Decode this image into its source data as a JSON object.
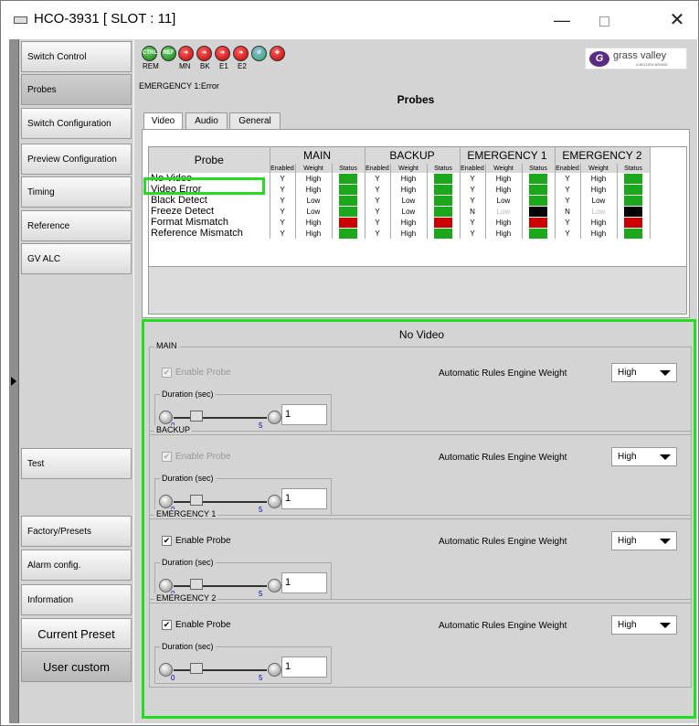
{
  "window": {
    "title": "HCO-3931 [ SLOT : 11]",
    "minimize": "—",
    "close": "✕"
  },
  "sidebar": {
    "items": [
      {
        "label": "Switch Control"
      },
      {
        "label": "Probes"
      },
      {
        "label": "Switch Configuration"
      },
      {
        "label": "Preview Configuration"
      },
      {
        "label": "Timing"
      },
      {
        "label": "Reference"
      },
      {
        "label": "GV ALC"
      },
      {
        "label": "Test"
      },
      {
        "label": "Factory/Presets"
      },
      {
        "label": "Alarm config."
      },
      {
        "label": "Information"
      },
      {
        "label": "Current Preset"
      },
      {
        "label": "User custom"
      }
    ]
  },
  "toolbar": {
    "icons": [
      {
        "text": "CTRL",
        "label": "REM",
        "color": "green"
      },
      {
        "text": "REF",
        "label": "",
        "color": "green"
      },
      {
        "text": "",
        "label": "MN",
        "color": "red"
      },
      {
        "text": "",
        "label": "BK",
        "color": "red"
      },
      {
        "text": "",
        "label": "E1",
        "color": "red"
      },
      {
        "text": "",
        "label": "E2",
        "color": "red"
      },
      {
        "text": "",
        "label": "",
        "color": "teal"
      },
      {
        "text": "",
        "label": "",
        "color": "red"
      }
    ],
    "logo_text": "grass valley",
    "logo_sub": "A BELDEN BRAND"
  },
  "status_text": "EMERGENCY 1:Error",
  "page_title": "Probes",
  "tabs": [
    "Video",
    "Audio",
    "General"
  ],
  "table": {
    "probe_header": "Probe",
    "groups": [
      "MAIN",
      "BACKUP",
      "EMERGENCY 1",
      "EMERGENCY 2"
    ],
    "sub": [
      "Enabled",
      "Weight",
      "Status"
    ],
    "rows": [
      {
        "name": "No Video",
        "cells": [
          [
            "Y",
            "High",
            "green"
          ],
          [
            "Y",
            "High",
            "green"
          ],
          [
            "Y",
            "High",
            "green"
          ],
          [
            "Y",
            "High",
            "green"
          ]
        ]
      },
      {
        "name": "Video Error",
        "cells": [
          [
            "Y",
            "High",
            "green"
          ],
          [
            "Y",
            "High",
            "green"
          ],
          [
            "Y",
            "High",
            "green"
          ],
          [
            "Y",
            "High",
            "green"
          ]
        ]
      },
      {
        "name": "Black Detect",
        "cells": [
          [
            "Y",
            "Low",
            "green"
          ],
          [
            "Y",
            "Low",
            "green"
          ],
          [
            "Y",
            "Low",
            "green"
          ],
          [
            "Y",
            "Low",
            "green"
          ]
        ]
      },
      {
        "name": "Freeze Detect",
        "cells": [
          [
            "Y",
            "Low",
            "green"
          ],
          [
            "Y",
            "Low",
            "green"
          ],
          [
            "N",
            "Low",
            "black"
          ],
          [
            "N",
            "Low",
            "black"
          ]
        ]
      },
      {
        "name": "Format Mismatch",
        "cells": [
          [
            "Y",
            "High",
            "red"
          ],
          [
            "Y",
            "High",
            "red"
          ],
          [
            "Y",
            "High",
            "red"
          ],
          [
            "Y",
            "High",
            "red"
          ]
        ]
      },
      {
        "name": "Reference Mismatch",
        "cells": [
          [
            "Y",
            "High",
            "green"
          ],
          [
            "Y",
            "High",
            "green"
          ],
          [
            "Y",
            "High",
            "green"
          ],
          [
            "Y",
            "High",
            "green"
          ]
        ]
      }
    ]
  },
  "detail": {
    "title": "No Video",
    "groups": [
      {
        "name": "MAIN",
        "enable_label": "Enable Probe",
        "checked": true,
        "disabled": true,
        "rules_label": "Automatic Rules Engine Weight",
        "weight": "High",
        "duration_label": "Duration (sec)",
        "min": "0",
        "max": "5",
        "value": "1"
      },
      {
        "name": "BACKUP",
        "enable_label": "Enable Probe",
        "checked": true,
        "disabled": true,
        "rules_label": "Automatic Rules Engine Weight",
        "weight": "High",
        "duration_label": "Duration (sec)",
        "min": "0",
        "max": "5",
        "value": "1"
      },
      {
        "name": "EMERGENCY 1",
        "enable_label": "Enable Probe",
        "checked": true,
        "disabled": false,
        "rules_label": "Automatic Rules Engine Weight",
        "weight": "High",
        "duration_label": "Duration (sec)",
        "min": "0",
        "max": "5",
        "value": "1"
      },
      {
        "name": "EMERGENCY 2",
        "enable_label": "Enable Probe",
        "checked": true,
        "disabled": false,
        "rules_label": "Automatic Rules Engine Weight",
        "weight": "High",
        "duration_label": "Duration (sec)",
        "min": "0",
        "max": "5",
        "value": "1"
      }
    ]
  }
}
